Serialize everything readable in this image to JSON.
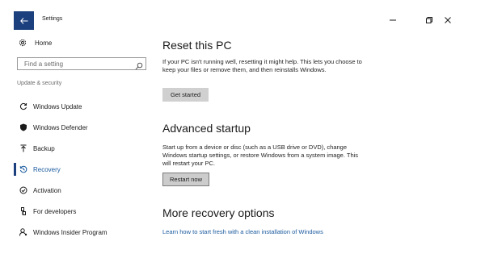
{
  "window": {
    "title": "Settings",
    "controls": [
      "minimize-icon",
      "restore-icon",
      "close-icon"
    ]
  },
  "sidebar": {
    "home_label": "Home",
    "search_placeholder": "Find a setting",
    "section_label": "Update & security",
    "items": [
      {
        "label": "Windows Update",
        "icon": "sync-icon",
        "active": false
      },
      {
        "label": "Windows Defender",
        "icon": "shield-icon",
        "active": false
      },
      {
        "label": "Backup",
        "icon": "upload-icon",
        "active": false
      },
      {
        "label": "Recovery",
        "icon": "history-icon",
        "active": true
      },
      {
        "label": "Activation",
        "icon": "check-circle-icon",
        "active": false
      },
      {
        "label": "For developers",
        "icon": "developer-icon",
        "active": false
      },
      {
        "label": "Windows Insider Program",
        "icon": "person-icon",
        "active": false
      }
    ]
  },
  "main": {
    "reset": {
      "heading": "Reset this PC",
      "description": "If your PC isn't running well, resetting it might help. This lets you choose to keep your files or remove them, and then reinstalls Windows.",
      "button": "Get started"
    },
    "advanced": {
      "heading": "Advanced startup",
      "description": "Start up from a device or disc (such as a USB drive or DVD), change Windows startup settings, or restore Windows from a system image. This will restart your PC.",
      "button": "Restart now"
    },
    "more": {
      "heading": "More recovery options",
      "link": "Learn how to start fresh with a clean installation of Windows"
    }
  },
  "colors": {
    "accent": "#1c3f7e",
    "link": "#1a5a9e",
    "button_bg": "#d0d0d0"
  }
}
